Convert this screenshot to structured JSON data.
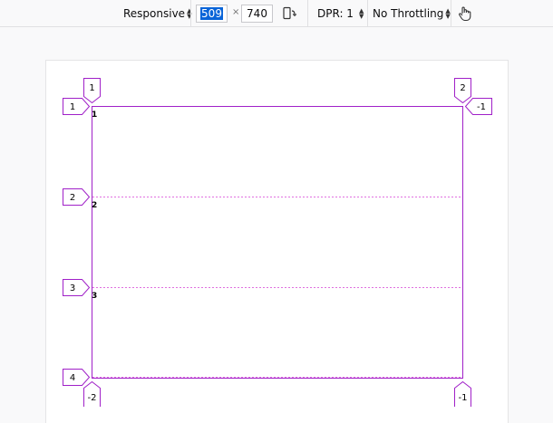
{
  "toolbar": {
    "device": "Responsive",
    "width_value": "509",
    "times_symbol": "×",
    "height_value": "740",
    "dpr": "DPR: 1",
    "throttling": "No Throttling",
    "rotate_icon": "rotate-device-icon",
    "touch_icon": "touch-simulation-icon"
  },
  "grid": {
    "line_color": "#a020c8",
    "dash_color": "#e070e0",
    "column_top_labels": [
      "1",
      "2"
    ],
    "column_bottom_labels": [
      "-2",
      "-1"
    ],
    "row_left_labels": [
      "1",
      "2",
      "3",
      "4"
    ],
    "row_right_label": "-1",
    "area_numbers": [
      "1",
      "2",
      "3"
    ]
  }
}
